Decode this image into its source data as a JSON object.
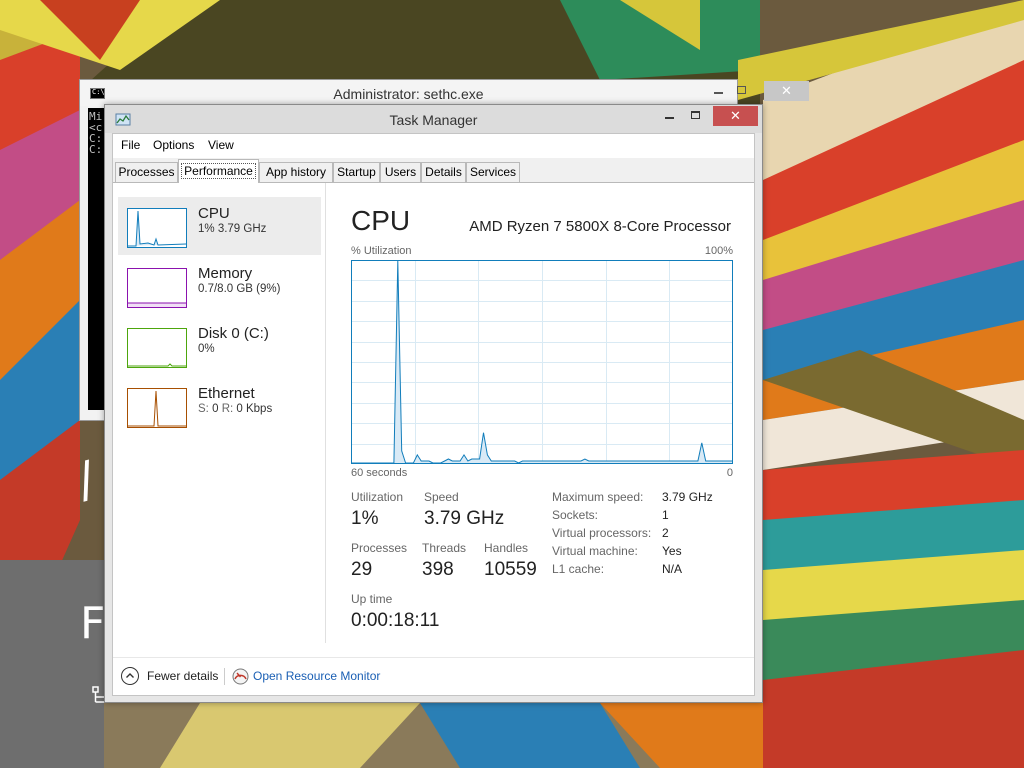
{
  "desktop": {
    "glyph_slash": "/",
    "glyph_f": "F",
    "network_icon": "network-icon"
  },
  "cmd": {
    "title": "Administrator: sethc.exe",
    "close_glyph": "✕",
    "lines": [
      "Mi",
      "<c",
      "",
      "C:",
      "",
      "C:"
    ]
  },
  "taskmgr": {
    "title": "Task Manager",
    "close_glyph": "✕",
    "menu": {
      "file": "File",
      "options": "Options",
      "view": "View"
    },
    "tabs": [
      "Processes",
      "Performance",
      "App history",
      "Startup",
      "Users",
      "Details",
      "Services"
    ],
    "active_tab": "Performance",
    "sidebar": [
      {
        "name": "CPU",
        "detail": "1%  3.79 GHz",
        "color": "#117dbb"
      },
      {
        "name": "Memory",
        "detail": "0.7/8.0 GB (9%)",
        "color": "#8b12ae"
      },
      {
        "name": "Disk 0 (C:)",
        "detail": "0%",
        "color": "#4da60c"
      },
      {
        "name": "Ethernet",
        "detail_label_s": "S:",
        "detail_value_s": "0",
        "detail_label_r": "R:",
        "detail_value_r": "0 Kbps",
        "color": "#a74f01"
      }
    ],
    "panel": {
      "title": "CPU",
      "processor": "AMD Ryzen 7 5800X 8-Core Processor",
      "util_label": "% Utilization",
      "util_max": "100%",
      "time_label": "60 seconds",
      "time_min": "0",
      "stats": {
        "utilization_label": "Utilization",
        "utilization": "1%",
        "speed_label": "Speed",
        "speed": "3.79 GHz",
        "processes_label": "Processes",
        "processes": "29",
        "threads_label": "Threads",
        "threads": "398",
        "handles_label": "Handles",
        "handles": "10559",
        "uptime_label": "Up time",
        "uptime": "0:00:18:11"
      },
      "specs": [
        {
          "label": "Maximum speed:",
          "value": "3.79 GHz"
        },
        {
          "label": "Sockets:",
          "value": "1"
        },
        {
          "label": "Virtual processors:",
          "value": "2"
        },
        {
          "label": "Virtual machine:",
          "value": "Yes"
        },
        {
          "label": "L1 cache:",
          "value": "N/A"
        }
      ]
    },
    "footer": {
      "fewer_details": "Fewer details",
      "open_rm": "Open Resource Monitor"
    }
  },
  "chart_data": {
    "type": "area",
    "title": "CPU",
    "ylabel": "% Utilization",
    "xlabel": "60 seconds",
    "ylim": [
      0,
      100
    ],
    "xlim": [
      60,
      0
    ],
    "grid": true,
    "color": "#117dbb",
    "series": [
      {
        "values": [
          0,
          0,
          0,
          0,
          0,
          0,
          0,
          0,
          0,
          0,
          0,
          0,
          100,
          6,
          0,
          0,
          0,
          4,
          1,
          1,
          1,
          0,
          0,
          0,
          1,
          2,
          1,
          1,
          1,
          4,
          1,
          2,
          2,
          2,
          15,
          4,
          1,
          1,
          1,
          1,
          1,
          1,
          1,
          0,
          1,
          1,
          1,
          1,
          1,
          1,
          1,
          1,
          1,
          1,
          1,
          1,
          1,
          1,
          1,
          1,
          2,
          1,
          1,
          1,
          1,
          1,
          1,
          1,
          1,
          1,
          1,
          1,
          1,
          1,
          1,
          1,
          1,
          1,
          1,
          1,
          1,
          1,
          1,
          1,
          1,
          1,
          1,
          1,
          1,
          1,
          10,
          1,
          1,
          1,
          1,
          1,
          1,
          1,
          1
        ]
      }
    ]
  }
}
